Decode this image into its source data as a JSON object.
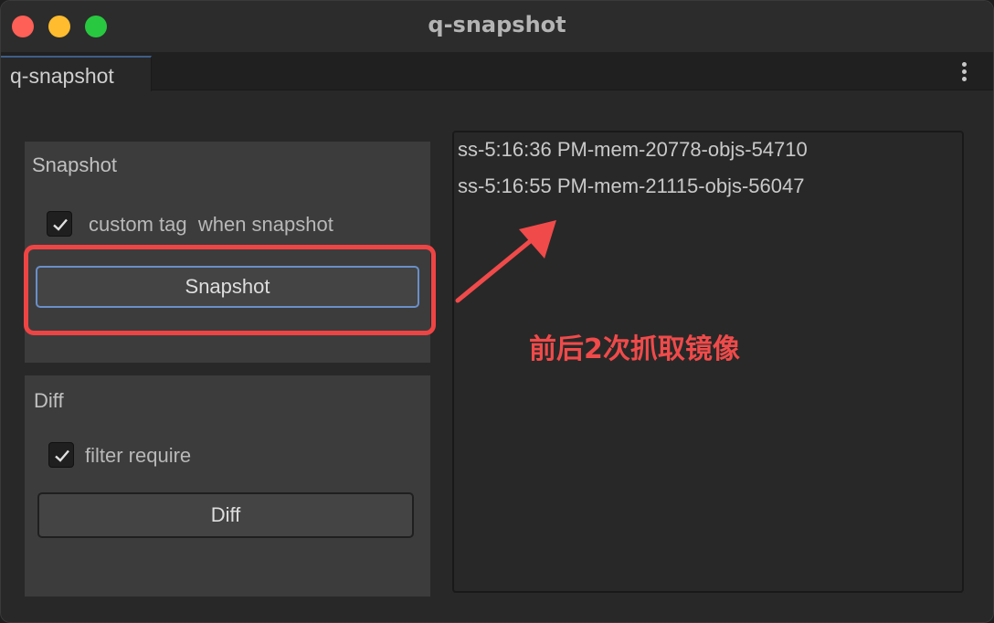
{
  "window": {
    "title": "q-snapshot"
  },
  "tabs": [
    {
      "label": "q-snapshot"
    }
  ],
  "snapshot_panel": {
    "title": "Snapshot",
    "checkbox_label": "custom tag  when snapshot",
    "checkbox_checked": true,
    "button_label": "Snapshot"
  },
  "diff_panel": {
    "title": "Diff",
    "checkbox_label": "filter require",
    "checkbox_checked": true,
    "button_label": "Diff"
  },
  "snapshot_list": {
    "items": [
      "ss-5:16:36 PM-mem-20778-objs-54710",
      "ss-5:16:55 PM-mem-21115-objs-56047"
    ]
  },
  "annotation": {
    "text": "前后2次抓取镜像",
    "color": "#f04a4a"
  },
  "icons": {
    "window_controls": [
      "close-icon",
      "minimize-icon",
      "zoom-icon"
    ],
    "tab_menu": "more-vertical-icon",
    "checkbox": "checkmark-icon",
    "annotation_arrow": "arrow-icon"
  }
}
